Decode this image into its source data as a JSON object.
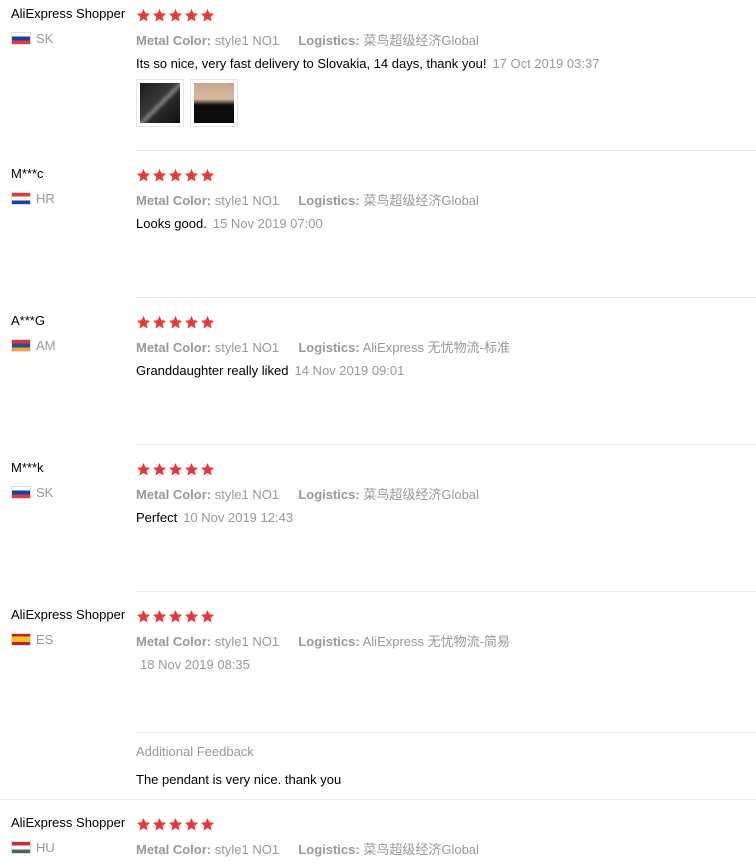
{
  "reviews": [
    {
      "user": "AliExpress Shopper",
      "country": "SK",
      "flag": "sk",
      "stars": 5,
      "color_label": "Metal Color:",
      "color_value": "style1 NO1",
      "logistics_label": "Logistics:",
      "logistics_value": "菜鸟超级经济Global",
      "text": "Its so nice, very fast delivery to Slovakia, 14 days, thank you!",
      "date": "17 Oct 2019 03:37",
      "photos": [
        "review-photo-1",
        "review-photo-2"
      ]
    },
    {
      "user": "M***c",
      "country": "HR",
      "flag": "hr",
      "stars": 5,
      "color_label": "Metal Color:",
      "color_value": "style1 NO1",
      "logistics_label": "Logistics:",
      "logistics_value": "菜鸟超级经济Global",
      "text": "Looks good.",
      "date": "15 Nov 2019 07:00"
    },
    {
      "user": "A***G",
      "country": "AM",
      "flag": "am",
      "stars": 5,
      "color_label": "Metal Color:",
      "color_value": "style1 NO1",
      "logistics_label": "Logistics:",
      "logistics_value": "AliExpress 无忧物流-标准",
      "text": "Granddaughter really liked",
      "date": "14 Nov 2019 09:01"
    },
    {
      "user": "M***k",
      "country": "SK",
      "flag": "sk",
      "stars": 5,
      "color_label": "Metal Color:",
      "color_value": "style1 NO1",
      "logistics_label": "Logistics:",
      "logistics_value": "菜鸟超级经济Global",
      "text": "Perfect",
      "date": "10 Nov 2019 12:43"
    },
    {
      "user": "AliExpress Shopper",
      "country": "ES",
      "flag": "es",
      "stars": 5,
      "color_label": "Metal Color:",
      "color_value": "style1 NO1",
      "logistics_label": "Logistics:",
      "logistics_value": "AliExpress 无忧物流-简易",
      "text": "",
      "date": "18 Nov 2019 08:35",
      "additional_title": "Additional Feedback",
      "additional_text": "The pendant is very nice. thank you"
    },
    {
      "user": "AliExpress Shopper",
      "country": "HU",
      "flag": "hu",
      "stars": 5,
      "color_label": "Metal Color:",
      "color_value": "style1 NO1",
      "logistics_label": "Logistics:",
      "logistics_value": "菜鸟超级经济Global"
    }
  ],
  "colors": {
    "star": "#e8373d",
    "muted": "#999999",
    "divider": "#ececec"
  }
}
